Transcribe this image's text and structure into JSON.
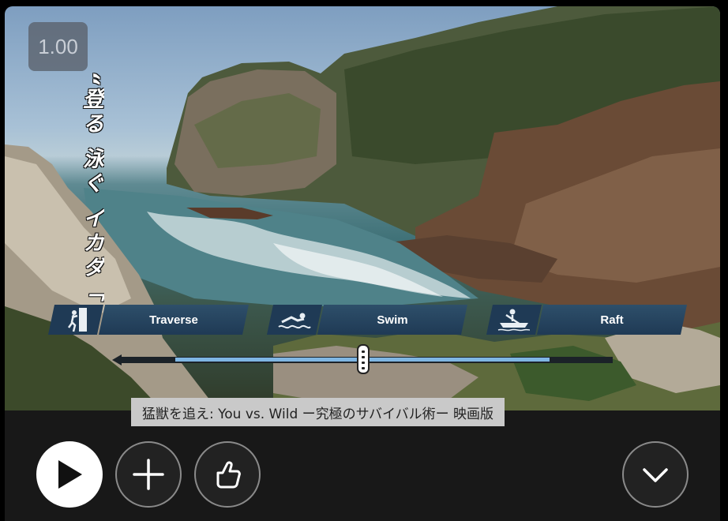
{
  "player": {
    "maturity_rating": "1.00",
    "tagline": "“登る 泳ぐ イカダ「",
    "choices": [
      {
        "label": "Traverse",
        "icon": "climber-icon"
      },
      {
        "label": "Swim",
        "icon": "swimmer-icon"
      },
      {
        "label": "Raft",
        "icon": "raft-icon"
      }
    ],
    "timeline_progress": 0.74,
    "caption": "猛獣を追え: You vs. Wild ー究極のサバイバル術ー 映画版"
  },
  "controls": {
    "play_icon": "play-icon",
    "add_icon": "plus-icon",
    "like_icon": "thumbs-up-icon",
    "more_icon": "chevron-down-icon"
  },
  "colors": {
    "choice_bg": "#1f3a55",
    "timeline_fill": "#7fb6e3",
    "card_bg": "#181818"
  }
}
